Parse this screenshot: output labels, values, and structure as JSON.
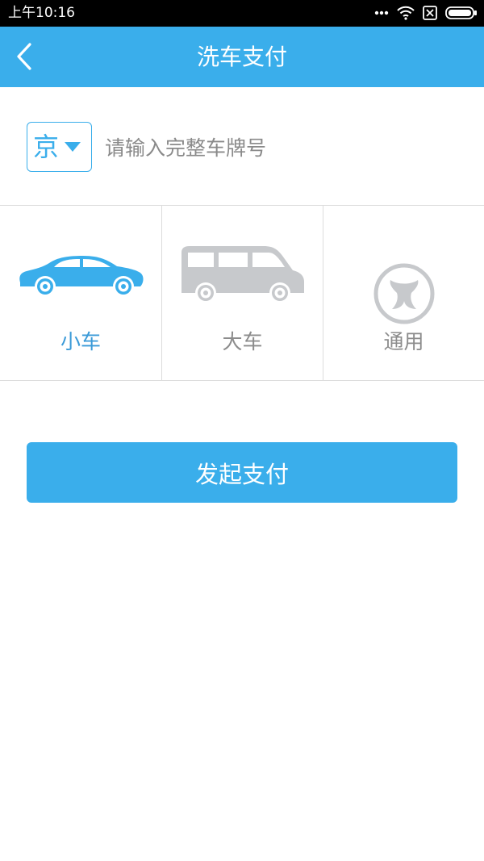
{
  "status_bar": {
    "time": "上午10:16",
    "icons": [
      "dots-icon",
      "wifi-icon",
      "sim-blocked-icon",
      "battery-icon"
    ]
  },
  "header": {
    "title": "洗车支付",
    "back_icon": "chevron-left-icon"
  },
  "plate": {
    "province": "京",
    "placeholder": "请输入完整车牌号",
    "value": ""
  },
  "vehicle_types": [
    {
      "label": "小车",
      "icon": "sedan-icon",
      "selected": true
    },
    {
      "label": "大车",
      "icon": "van-icon",
      "selected": false
    },
    {
      "label": "通用",
      "icon": "steering-wheel-icon",
      "selected": false
    }
  ],
  "pay_button": {
    "label": "发起支付"
  },
  "colors": {
    "accent": "#3aaeeb",
    "selected_text": "#3a9ad8",
    "inactive_icon": "#c7c9cc",
    "inactive_text": "#8c8c8c",
    "divider": "#dcdcdc"
  }
}
